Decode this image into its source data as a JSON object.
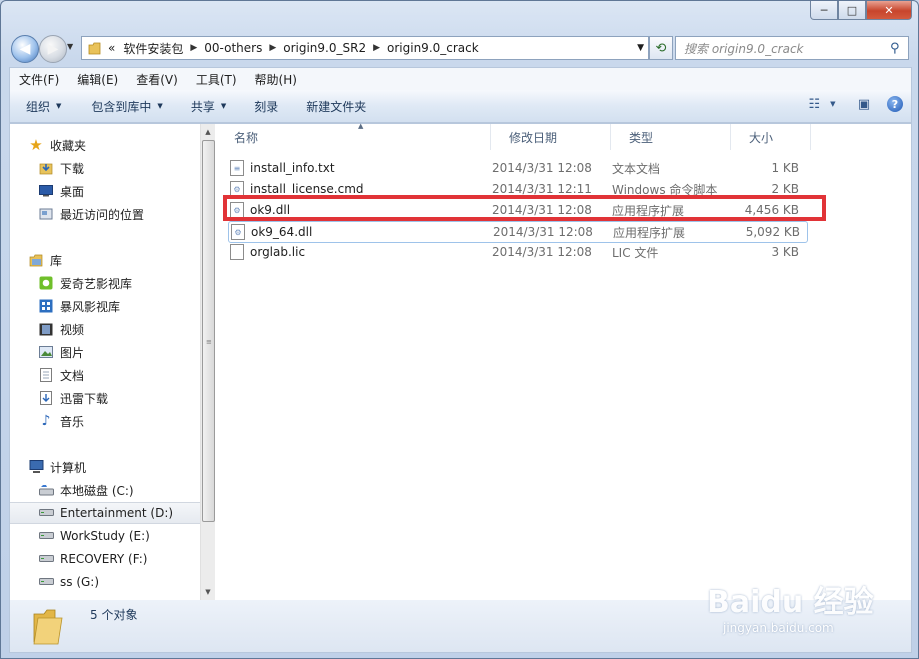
{
  "window": {
    "minimize": "─",
    "maximize": "□",
    "close": "✕"
  },
  "address": {
    "overflow": "«",
    "path": [
      "软件安装包",
      "00-others",
      "origin9.0_SR2",
      "origin9.0_crack"
    ],
    "search_placeholder": "搜索 origin9.0_crack"
  },
  "menu": [
    "文件(F)",
    "编辑(E)",
    "查看(V)",
    "工具(T)",
    "帮助(H)"
  ],
  "commands": [
    "组织",
    "包含到库中",
    "共享",
    "刻录",
    "新建文件夹"
  ],
  "nav": {
    "favorites": {
      "label": "收藏夹",
      "items": [
        "下载",
        "桌面",
        "最近访问的位置"
      ]
    },
    "libraries": {
      "label": "库",
      "items": [
        "爱奇艺影视库",
        "暴风影视库",
        "视频",
        "图片",
        "文档",
        "迅雷下载",
        "音乐"
      ]
    },
    "computer": {
      "label": "计算机",
      "items": [
        "本地磁盘 (C:)",
        "Entertainment (D:)",
        "WorkStudy (E:)",
        "RECOVERY (F:)",
        "ss (G:)"
      ]
    }
  },
  "columns": {
    "name": "名称",
    "date": "修改日期",
    "type": "类型",
    "size": "大小"
  },
  "files": [
    {
      "name": "install_info.txt",
      "date": "2014/3/31 12:08",
      "type": "文本文档",
      "size": "1 KB"
    },
    {
      "name": "install_license.cmd",
      "date": "2014/3/31 12:11",
      "type": "Windows 命令脚本",
      "size": "2 KB"
    },
    {
      "name": "ok9.dll",
      "date": "2014/3/31 12:08",
      "type": "应用程序扩展",
      "size": "4,456 KB"
    },
    {
      "name": "ok9_64.dll",
      "date": "2014/3/31 12:08",
      "type": "应用程序扩展",
      "size": "5,092 KB"
    },
    {
      "name": "orglab.lic",
      "date": "2014/3/31 12:08",
      "type": "LIC 文件",
      "size": "3 KB"
    }
  ],
  "status": {
    "count": "5 个对象"
  },
  "watermark": {
    "main": "Baidu 经验",
    "sub": "jingyan.baidu.com"
  },
  "colors": {
    "highlight": "#e13337",
    "accent": "#1e395b"
  }
}
